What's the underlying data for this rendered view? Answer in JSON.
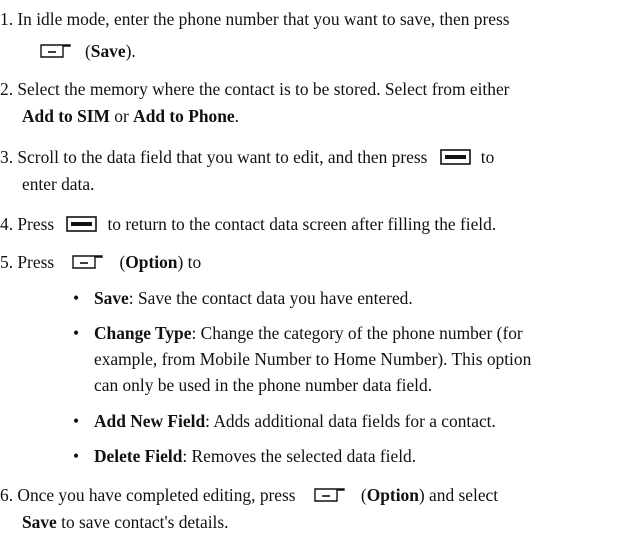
{
  "items": {
    "s1a": "1. In idle mode, enter the phone number that you want to save, then press",
    "s1b_open": "(",
    "s1b_bold": "Save",
    "s1b_close": ").",
    "s2a": "2. Select the memory where the contact is to be stored. Select from either",
    "s2b_b1": "Add to SIM",
    "s2b_mid": " or ",
    "s2b_b2": "Add to Phone",
    "s2b_end": ".",
    "s3a_pre": "3. Scroll to the data field that you want to edit, and then press",
    "s3a_post": "to",
    "s3b": "enter data.",
    "s4_pre": "4. Press",
    "s4_post": "to return to the contact data screen after filling the field.",
    "s5_pre": "5. Press",
    "s5_open": "(",
    "s5_bold": "Option",
    "s5_close": ") to",
    "b1_bold": "Save",
    "b1_text": ": Save the contact data you have entered.",
    "b2_bold": "Change Type",
    "b2_text1": ": Change the category of the phone number (for",
    "b2_text2": "example, from Mobile Number to Home Number). This option",
    "b2_text3": "can only be used in the phone number data field.",
    "b3_bold": "Add New Field",
    "b3_text": ": Adds additional data fields for a contact.",
    "b4_bold": "Delete Field",
    "b4_text": ": Removes the selected data field.",
    "s6_pre": "6. Once you have completed editing, press",
    "s6_open": "(",
    "s6_bold": "Option",
    "s6_close": ") and select",
    "s6b_bold": "Save",
    "s6b_text": " to save contact's details.",
    "bullet": "•"
  },
  "icons": {
    "soft_key": "soft-key-icon",
    "center_key": "center-key-icon"
  }
}
